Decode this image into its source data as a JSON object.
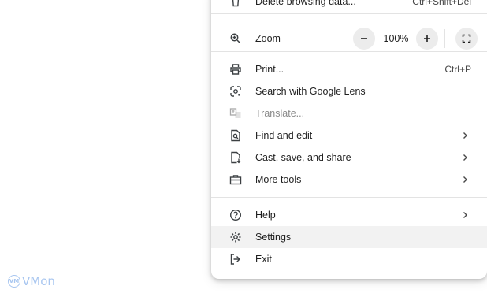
{
  "menu": {
    "delete_browsing_data": {
      "label": "Delete browsing data...",
      "shortcut": "Ctrl+Shift+Del"
    },
    "zoom": {
      "label": "Zoom",
      "level": "100%"
    },
    "print": {
      "label": "Print...",
      "shortcut": "Ctrl+P"
    },
    "search_lens": {
      "label": "Search with Google Lens"
    },
    "translate": {
      "label": "Translate..."
    },
    "find_edit": {
      "label": "Find and edit"
    },
    "cast_save_share": {
      "label": "Cast, save, and share"
    },
    "more_tools": {
      "label": "More tools"
    },
    "help": {
      "label": "Help"
    },
    "settings": {
      "label": "Settings"
    },
    "exit": {
      "label": "Exit"
    }
  },
  "watermark": {
    "badge": "VM",
    "text": "VMon"
  },
  "colors": {
    "menu_bg": "#ffffff",
    "hover_bg": "#f2f2f2",
    "divider": "#e3e3e3",
    "zoom_button_bg": "#ececec",
    "disabled_text": "#8a8a8a",
    "watermark": "#a8c6f0"
  }
}
